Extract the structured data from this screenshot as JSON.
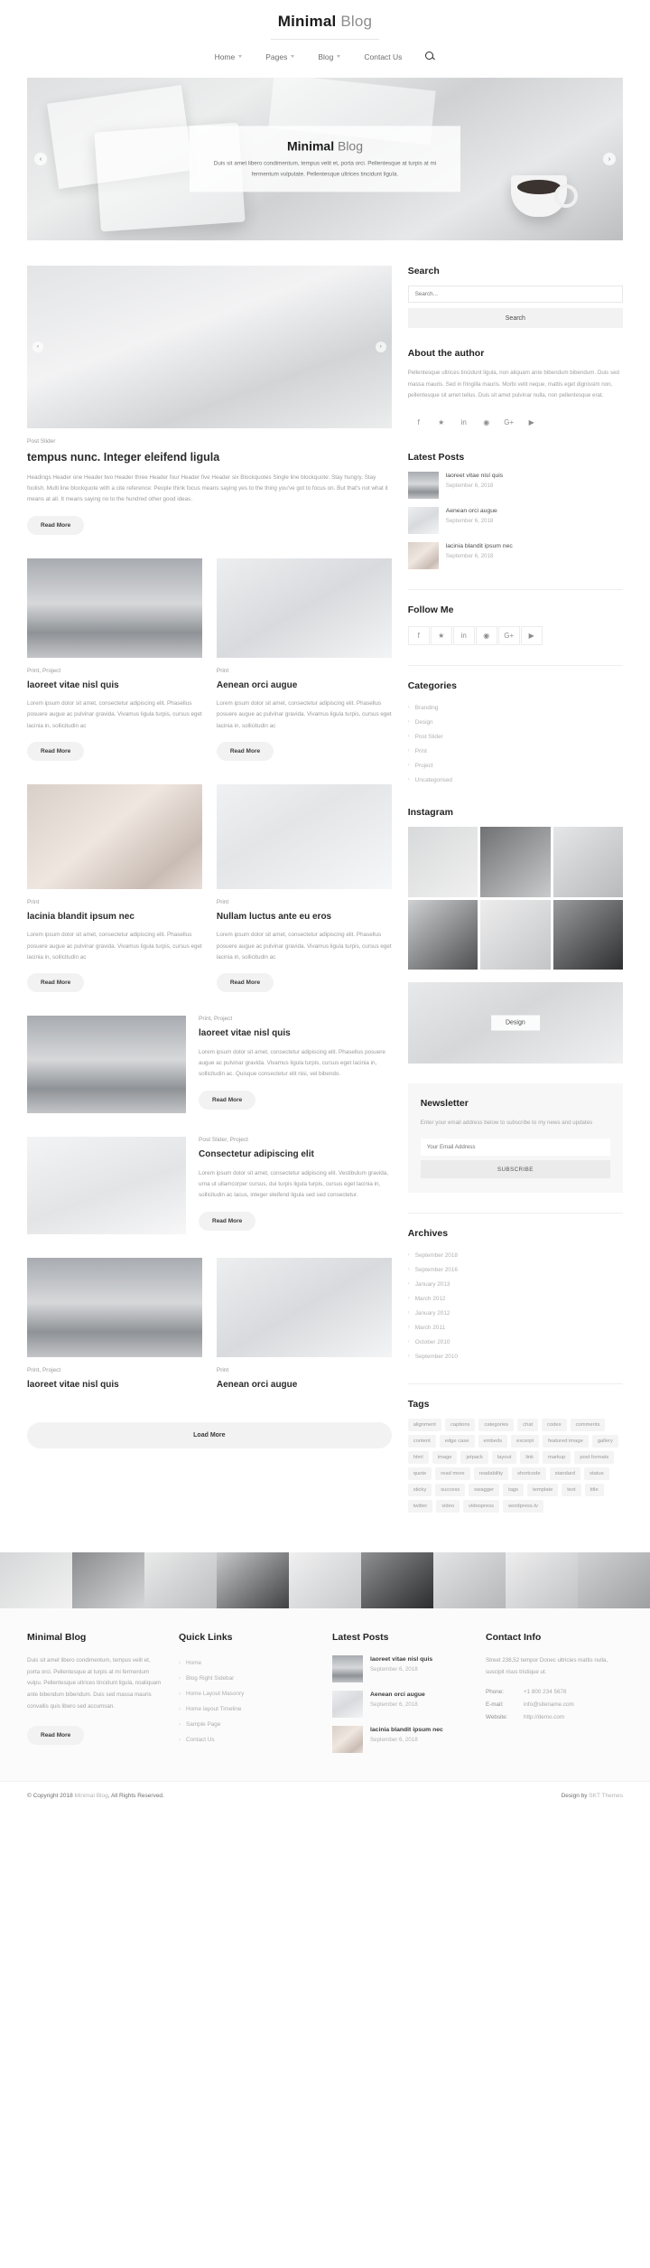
{
  "header": {
    "logo_bold": "Minimal",
    "logo_light": "Blog",
    "nav": [
      {
        "label": "Home",
        "has_caret": true
      },
      {
        "label": "Pages",
        "has_caret": true
      },
      {
        "label": "Blog",
        "has_caret": true
      },
      {
        "label": "Contact Us",
        "has_caret": false
      }
    ],
    "search_icon": "search-icon"
  },
  "hero": {
    "title_bold": "Minimal",
    "title_light": "Blog",
    "subtitle": "Duis sit amet libero condimentum, tempus velit et, porta orci. Pellentesque at turpis at mi fermentum vulputate. Pellentesque ultrices tincidunt ligula.",
    "prev": "‹",
    "next": "›"
  },
  "posts": [
    {
      "category": "Post Slider",
      "title": "tempus nunc. Integer eleifend ligula",
      "excerpt": "Headings Header one Header two Header three Header four Header five Header six Blockquotes Single line blockquote: Stay hungry. Stay foolish. Multi line blockquote with a cite reference: People think focus means saying yes to the thing you've got to focus on. But that's not what it means at all. It means saying no to the hundred other good ideas.",
      "read_more": "Read More"
    },
    {
      "category": "Print, Project",
      "title": "laoreet vitae nisl quis",
      "excerpt": "Lorem ipsum dolor sit amet, consectetur adipiscing elit. Phasellus posuere augue ac pulvinar gravida. Vivamus ligula turpis, cursus eget lacinia in, sollicitudin ac",
      "read_more": "Read More"
    },
    {
      "category": "Print",
      "title": "Aenean orci augue",
      "excerpt": "Lorem ipsum dolor sit amet, consectetur adipiscing elit. Phasellus posuere augue ac pulvinar gravida. Vivamus ligula turpis, cursus eget lacinia in, sollicitudin ac",
      "read_more": "Read More"
    },
    {
      "category": "Print",
      "title": "lacinia blandit ipsum nec",
      "excerpt": "Lorem ipsum dolor sit amet, consectetur adipiscing elit. Phasellus posuere augue ac pulvinar gravida. Vivamus ligula turpis, cursus eget lacinia in, sollicitudin ac",
      "read_more": "Read More"
    },
    {
      "category": "Print",
      "title": "Nullam luctus ante eu eros",
      "excerpt": "Lorem ipsum dolor sit amet, consectetur adipiscing elit. Phasellus posuere augue ac pulvinar gravida. Vivamus ligula turpis, cursus eget lacinia in, sollicitudin ac",
      "read_more": "Read More"
    },
    {
      "category": "Print, Project",
      "title": "laoreet vitae nisl quis",
      "excerpt": "Lorem ipsum dolor sit amet, consectetur adipiscing elit. Phasellus posuere augue ac pulvinar gravida. Vivamus ligula turpis, cursus eget lacinia in, sollicitudin ac. Quisque consectetur elit nisi, vel bibendo.",
      "read_more": "Read More"
    },
    {
      "category": "Post Slider, Project",
      "title": "Consectetur adipiscing elit",
      "excerpt": "Lorem ipsum dolor sit amet, consectetur adipiscing elit. Vestibulum gravida, urna ut ullamcorper cursus, dui turpis ligula turpis, cursus eget lacinia in, sollicitudin ac lacus, integer eleifend ligula sed sed consectetur.",
      "read_more": "Read More"
    },
    {
      "category": "Print, Project",
      "title": "laoreet vitae nisl quis",
      "excerpt": "",
      "read_more": ""
    },
    {
      "category": "Print",
      "title": "Aenean orci augue",
      "excerpt": "",
      "read_more": ""
    }
  ],
  "load_more": "Load More",
  "sidebar": {
    "search": {
      "title": "Search",
      "placeholder": "Search...",
      "button": "Search"
    },
    "about": {
      "title": "About the author",
      "text": "Pellentesque ultrices tincidunt ligula, non aliquam ante bibendum bibendum. Duis sed massa mauris. Sed in fringilla mauris. Morbi velit neque, mattis eget dignissim non, pellentesque sit amet tellus. Duis sit amet pulvinar nulla, non pellentesque erat.",
      "socials": [
        "facebook-icon",
        "twitter-icon",
        "linkedin-icon",
        "pinterest-icon",
        "googleplus-icon",
        "youtube-icon"
      ]
    },
    "latest_posts": {
      "title": "Latest Posts",
      "items": [
        {
          "title": "laoreet vitae nisl quis",
          "date": "September 6, 2018"
        },
        {
          "title": "Aenean orci augue",
          "date": "September 6, 2018"
        },
        {
          "title": "lacinia blandit ipsum nec",
          "date": "September 6, 2018"
        }
      ]
    },
    "follow_me": {
      "title": "Follow Me",
      "socials": [
        "facebook-icon",
        "twitter-icon",
        "linkedin-icon",
        "pinterest-icon",
        "googleplus-icon",
        "youtube-icon"
      ]
    },
    "categories": {
      "title": "Categories",
      "items": [
        "Branding",
        "Design",
        "Post Slider",
        "Print",
        "Project",
        "Uncategorised"
      ]
    },
    "instagram": {
      "title": "Instagram",
      "cells": 6
    },
    "banner": {
      "label": "Design"
    },
    "newsletter": {
      "title": "Newsletter",
      "text": "Enter your email address below to subscribe to my news and updates",
      "placeholder": "Your Email Address",
      "button": "SUBSCRIBE"
    },
    "archives": {
      "title": "Archives",
      "items": [
        "September 2018",
        "September 2016",
        "January 2013",
        "March 2012",
        "January 2012",
        "March 2011",
        "October 2010",
        "September 2010"
      ]
    },
    "tags": {
      "title": "Tags",
      "items": [
        "alignment",
        "captions",
        "categories",
        "chat",
        "codex",
        "comments",
        "content",
        "edge case",
        "embeds",
        "excerpt",
        "featured image",
        "gallery",
        "html",
        "image",
        "jetpack",
        "layout",
        "link",
        "markup",
        "post formats",
        "quote",
        "read more",
        "readability",
        "shortcode",
        "standard",
        "status",
        "sticky",
        "success",
        "swagger",
        "tags",
        "template",
        "text",
        "title",
        "twitter",
        "video",
        "videopress",
        "wordpress.tv"
      ]
    }
  },
  "footer": {
    "about": {
      "title": "Minimal Blog",
      "text": "Duis sit amet libero condimentum, tempus velit et, porta orci. Pellentesque at turpis at mi fermentum vulpu. Pellentesque ultrices tincidunt ligula, noaliquam ante bibendum bibendum. Duis sed massa mauris convallis quis libero sed accumsan.",
      "button": "Read More"
    },
    "quick_links": {
      "title": "Quick Links",
      "items": [
        "Home",
        "Blog Right Sidebar",
        "Home Layout Masonry",
        "Home layout Timeline",
        "Sample Page",
        "Contact Us"
      ]
    },
    "latest_posts": {
      "title": "Latest Posts",
      "items": [
        {
          "title": "laoreet vitae nisl quis",
          "date": "September 6, 2018"
        },
        {
          "title": "Aenean orci augue",
          "date": "September 6, 2018"
        },
        {
          "title": "lacinia blandit ipsum nec",
          "date": "September 6, 2018"
        }
      ]
    },
    "contact": {
      "title": "Contact Info",
      "address": "Street 238,52 tempor Donec ultricies mattis nulla, suscipit risus tristique ut.",
      "rows": [
        {
          "key": "Phone:",
          "value": "+1 800 234 5678"
        },
        {
          "key": "E-mail:",
          "value": "info@sitename.com"
        },
        {
          "key": "Website:",
          "value": "http://demo.com"
        }
      ]
    }
  },
  "copyright": {
    "prefix": "© Copyright 2018",
    "brand": "Minimal Blog",
    "suffix": ", All Rights Reserved.",
    "credit_prefix": "Design by ",
    "credit_brand": "SKT Themes"
  },
  "colors": {
    "accent": "#1c1c1c",
    "muted": "#a0a0a0",
    "panel": "#f2f2f2"
  }
}
